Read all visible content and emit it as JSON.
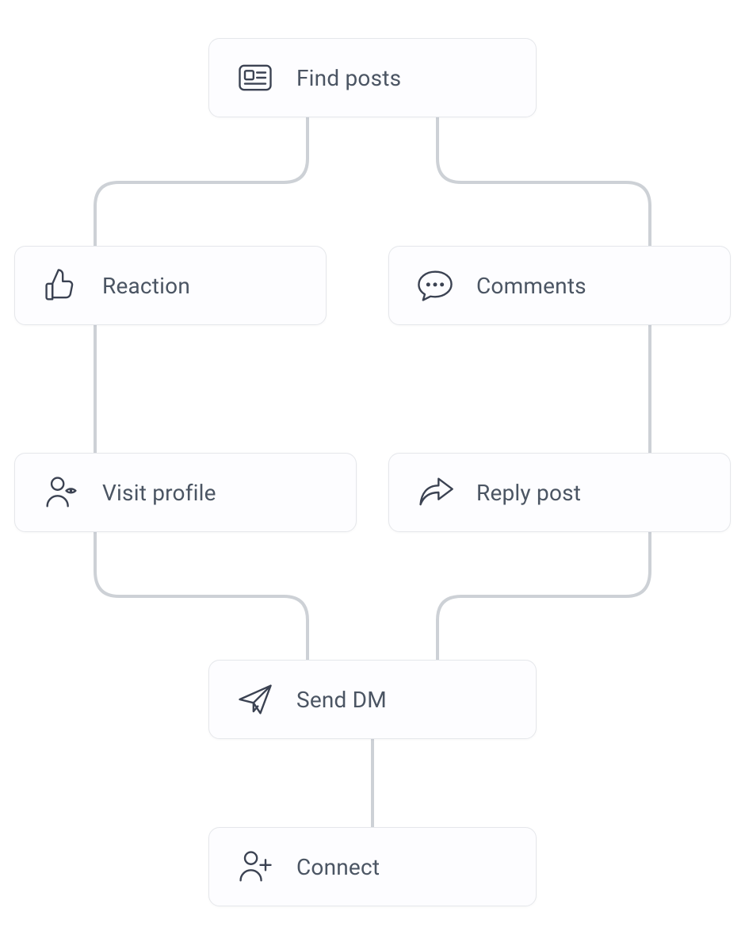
{
  "nodes": {
    "find_posts": {
      "label": "Find posts",
      "icon": "newspaper-icon"
    },
    "reaction": {
      "label": "Reaction",
      "icon": "thumbs-up-icon"
    },
    "comments": {
      "label": "Comments",
      "icon": "speech-bubble-icon"
    },
    "visit_profile": {
      "label": "Visit profile",
      "icon": "person-eye-icon"
    },
    "reply_post": {
      "label": "Reply post",
      "icon": "share-arrow-icon"
    },
    "send_dm": {
      "label": "Send DM",
      "icon": "paper-plane-icon"
    },
    "connect": {
      "label": "Connect",
      "icon": "person-plus-icon"
    }
  },
  "edges": [
    [
      "find_posts",
      "reaction"
    ],
    [
      "find_posts",
      "comments"
    ],
    [
      "reaction",
      "visit_profile"
    ],
    [
      "comments",
      "reply_post"
    ],
    [
      "visit_profile",
      "send_dm"
    ],
    [
      "reply_post",
      "send_dm"
    ],
    [
      "send_dm",
      "connect"
    ]
  ],
  "colors": {
    "node_border": "#e5e7eb",
    "node_bg": "#fdfdff",
    "icon_stroke": "#3b4252",
    "label_text": "#4b5563",
    "connector": "#cdd1d6"
  }
}
